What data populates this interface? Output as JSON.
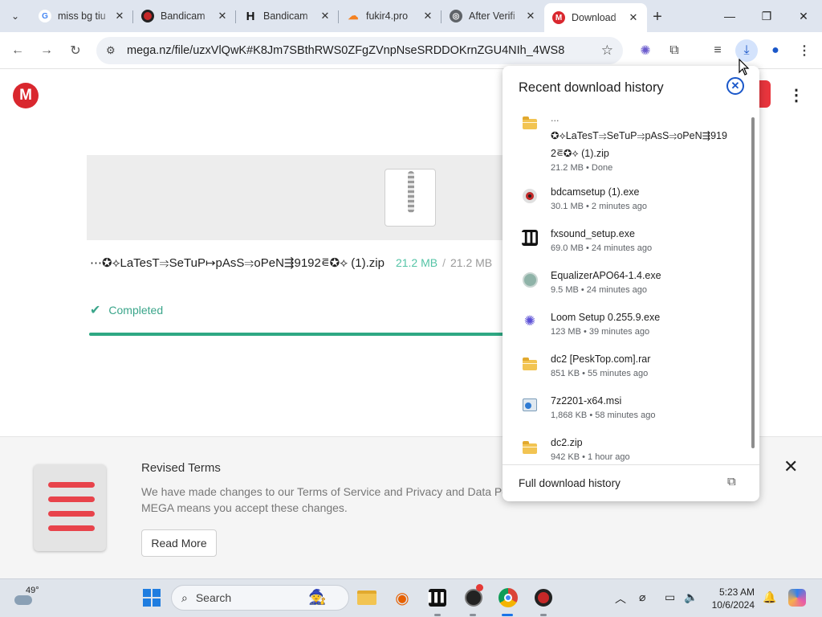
{
  "browser": {
    "tabs": [
      {
        "title": "miss bg tiu",
        "favicon": "google-icon",
        "color": "#4285f4",
        "glyph": "G"
      },
      {
        "title": "Bandicam",
        "favicon": "bandicam-icon",
        "color": "#c62828",
        "glyph": "●"
      },
      {
        "title": "Bandicam",
        "favicon": "h-icon",
        "color": "#111111",
        "glyph": "H"
      },
      {
        "title": "fukir4.pro",
        "favicon": "cloudflare-icon",
        "color": "#f48120",
        "glyph": "☁"
      },
      {
        "title": "After Verifi",
        "favicon": "globe-icon",
        "color": "#5f6368",
        "glyph": "◎"
      },
      {
        "title": "Download",
        "favicon": "mega-icon",
        "color": "#d9272e",
        "glyph": "M"
      }
    ],
    "url": "mega.nz/file/uzxVlQwK#K8Jm7SBthRWS0ZFgZVnpNseSRDDOKrnZGU4NIh_4WS8"
  },
  "page": {
    "file_name": "⋯✪⟡LaTesT⥤SeTuP↦pAsS⥤oPeN⇶9192⋷✪⟡ (1).zip",
    "size_done": "21.2 MB",
    "separator": "/",
    "size_total": "21.2 MB",
    "status": "Completed",
    "progress": 1.0,
    "terms": {
      "title": "Revised Terms",
      "text_line1": "We have made changes to our Terms of Service and Privacy and Data Policy",
      "text_line2": "MEGA means you accept these changes.",
      "button": "Read More"
    }
  },
  "downloads": {
    "title": "Recent download history",
    "items": [
      {
        "name_line1": "...",
        "name_line2": "✪⟡LaTesT⥤SeTuP⥤pAsS⥤oPeN⇶919",
        "name_line3": "2⋷✪⟡ (1).zip",
        "meta": "21.2 MB • Done",
        "icon": "folder-icon"
      },
      {
        "name": "bdcamsetup (1).exe",
        "meta": "30.1 MB • 2 minutes ago",
        "icon": "bandicam-icon"
      },
      {
        "name": "fxsound_setup.exe",
        "meta": "69.0 MB • 24 minutes ago",
        "icon": "fxsound-icon"
      },
      {
        "name": "EqualizerAPO64-1.4.exe",
        "meta": "9.5 MB • 24 minutes ago",
        "icon": "installer-icon"
      },
      {
        "name": "Loom Setup 0.255.9.exe",
        "meta": "123 MB • 39 minutes ago",
        "icon": "loom-icon"
      },
      {
        "name": "dc2 [PeskTop.com].rar",
        "meta": "851 KB • 55 minutes ago",
        "icon": "folder-icon"
      },
      {
        "name": "7z2201-x64.msi",
        "meta": "1,868 KB • 58 minutes ago",
        "icon": "msi-icon"
      },
      {
        "name": "dc2.zip",
        "meta": "942 KB • 1 hour ago",
        "icon": "folder-icon"
      }
    ],
    "footer": "Full download history"
  },
  "taskbar": {
    "weather": "49°",
    "search": "Search",
    "time": "5:23 AM",
    "date": "10/6/2024"
  }
}
